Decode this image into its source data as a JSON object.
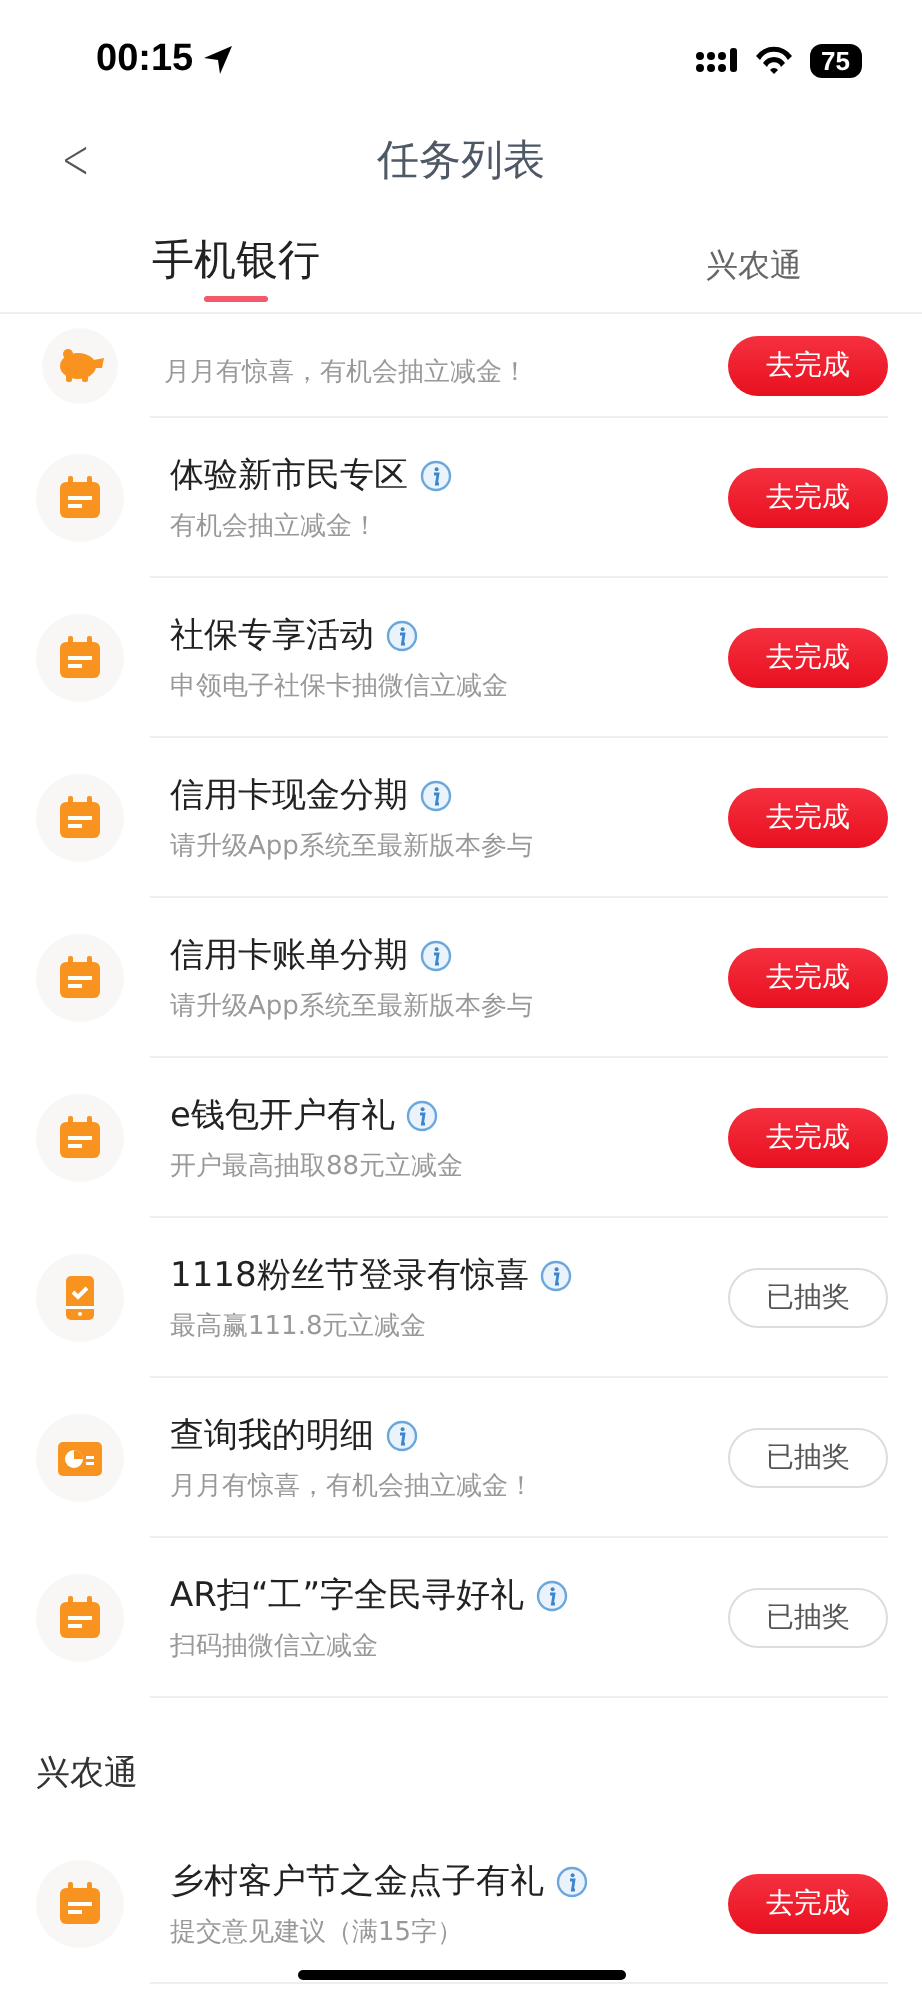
{
  "status_bar": {
    "time": "00:15",
    "battery": "75"
  },
  "nav": {
    "title": "任务列表",
    "back": "<"
  },
  "tabs": [
    {
      "label": "手机银行",
      "selected": true
    },
    {
      "label": "兴农通",
      "selected": false
    }
  ],
  "sections": [
    {
      "tasks": [
        {
          "kind": "savings",
          "subtitle": "月月有惊喜，有机会抽立减金！",
          "button": {
            "label": "去完成",
            "done": false
          }
        },
        {
          "kind": "calendar",
          "title": "体验新市民专区",
          "subtitle": "有机会抽立减金！",
          "button": {
            "label": "去完成",
            "done": false
          }
        },
        {
          "kind": "calendar",
          "title": "社保专享活动",
          "subtitle": "申领电子社保卡抽微信立减金",
          "button": {
            "label": "去完成",
            "done": false
          }
        },
        {
          "kind": "calendar",
          "title": "信用卡现金分期",
          "subtitle": "请升级App系统至最新版本参与",
          "button": {
            "label": "去完成",
            "done": false
          }
        },
        {
          "kind": "calendar",
          "title": "信用卡账单分期",
          "subtitle": "请升级App系统至最新版本参与",
          "button": {
            "label": "去完成",
            "done": false
          }
        },
        {
          "kind": "calendar",
          "title": "e钱包开户有礼",
          "subtitle": "开户最高抽取88元立减金",
          "button": {
            "label": "去完成",
            "done": false
          }
        },
        {
          "kind": "phone",
          "title": "1118粉丝节登录有惊喜",
          "subtitle": "最高赢111.8元立减金",
          "button": {
            "label": "已抽奖",
            "done": true
          }
        },
        {
          "kind": "statement",
          "title": "查询我的明细",
          "subtitle": "月月有惊喜，有机会抽立减金！",
          "button": {
            "label": "已抽奖",
            "done": true
          }
        },
        {
          "kind": "calendar",
          "title": "AR扫“工”字全民寻好礼",
          "subtitle": "扫码抽微信立减金",
          "button": {
            "label": "已抽奖",
            "done": true
          }
        }
      ]
    },
    {
      "heading": "兴农通",
      "tasks": [
        {
          "kind": "calendar",
          "title": "乡村客户节之金点子有礼",
          "subtitle": "提交意见建议（满15字）",
          "button": {
            "label": "去完成",
            "done": false
          }
        }
      ]
    }
  ]
}
